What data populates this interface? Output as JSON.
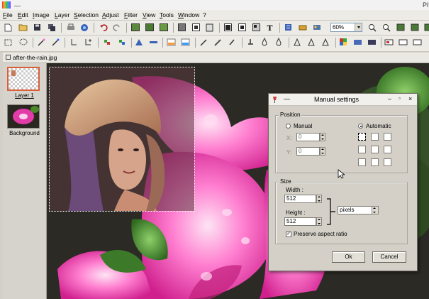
{
  "app": {
    "title": "PI",
    "dash": "—"
  },
  "menu": [
    "File",
    "Edit",
    "Image",
    "Layer",
    "Selection",
    "Adjust",
    "Filter",
    "View",
    "Tools",
    "Window",
    "?"
  ],
  "toolbar": {
    "zoom": "60%"
  },
  "document": {
    "title": "after-the-rain.jpg"
  },
  "layers": [
    {
      "label": "Layer 1",
      "selected": true
    },
    {
      "label": "Background",
      "selected": false
    }
  ],
  "dialog": {
    "title": "Manual settings",
    "position": {
      "group_label": "Position",
      "manual_label": "Manual",
      "automatic_label": "Automatic",
      "mode": "Automatic",
      "x_label": "X:",
      "x_value": "0",
      "y_label": "Y:",
      "y_value": "0"
    },
    "size": {
      "group_label": "Size",
      "width_label": "Width :",
      "width_value": "512",
      "height_label": "Height :",
      "height_value": "512",
      "unit": "pixels",
      "preserve_label": "Preserve aspect ratio",
      "preserve_checked": true
    },
    "ok_label": "Ok",
    "cancel_label": "Cancel"
  },
  "colors": {
    "accent": "#ff4fb8",
    "dialog_bg": "#d4d0c8",
    "toolbar_bg": "#ecebe6"
  }
}
